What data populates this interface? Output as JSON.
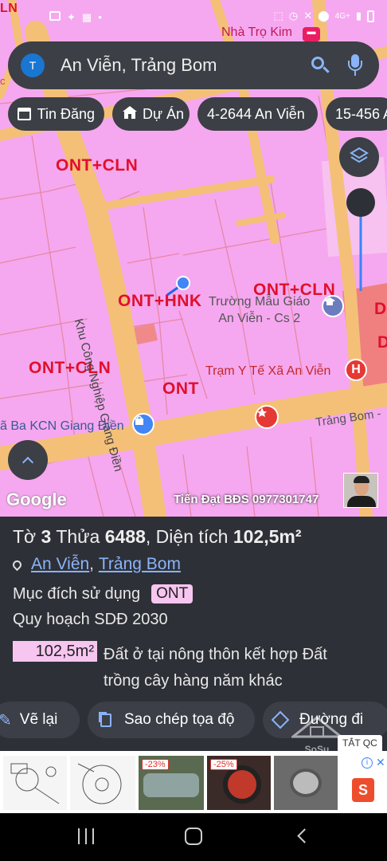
{
  "status_bar": {
    "signal": "4G+"
  },
  "search": {
    "avatar_letter": "T",
    "query": "An Viễn, Trảng Bom"
  },
  "chips": [
    {
      "label": "Tin Đăng",
      "icon": "calendar-icon"
    },
    {
      "label": "Dự Án",
      "icon": "house-icon"
    },
    {
      "label": "4-2644 An Viễn"
    },
    {
      "label": "15-456 A"
    }
  ],
  "map": {
    "zones": [
      "ONT+CLN",
      "ONT+HNK",
      "ONT+CLN",
      "ONT+CLN",
      "ONT",
      "D",
      "D"
    ],
    "places": {
      "nha_tro": "Nhà Trọ Kim",
      "school": "Trường Mẫu Giáo",
      "school_line2": "An Viễn - Cs 2",
      "clinic": "Trạm Y Tế Xã An Viễn",
      "road_vertical": "Khu Công Nghiệp Giang Điền",
      "road_right": "Trảng Bom -",
      "kcn": "ã Ba KCN Giang Điền",
      "edge_top": "LN",
      "edge_left": "c"
    },
    "google": "Google",
    "watermark": "Tiến Đạt BĐS 0977301747"
  },
  "panel": {
    "to_label": "Tờ",
    "to_value": "3",
    "thua_label": "Thửa",
    "thua_value": "6488",
    "dt_label": ", Diện tích",
    "dt_value": "102,5m²",
    "location_1": "An Viễn",
    "location_sep": ", ",
    "location_2": "Trảng Bom",
    "purpose_label": "Mục đích sử dụng",
    "purpose_badge": "ONT",
    "plan_label": "Quy hoạch SDĐ 2030",
    "area_badge": "102,5m²",
    "area_desc_line1": "Đất ở tại nông thôn kết hợp Đất",
    "area_desc_line2": "trồng cây hàng năm khác"
  },
  "actions": {
    "redraw": "Vẽ lại",
    "copy": "Sao chép tọa độ",
    "route": "Đường đi"
  },
  "ad": {
    "close_label": "TẮT QC",
    "discounts": [
      "-23%",
      "-25%"
    ],
    "brand_mark": "SoSu"
  },
  "colors": {
    "map_pink": "#f5a8ef",
    "road_orange": "#f4c078",
    "zone_red": "#e0102c",
    "panel_bg": "#2e3037",
    "chip_bg": "#3c3f45",
    "link_blue": "#8ab4f8"
  }
}
